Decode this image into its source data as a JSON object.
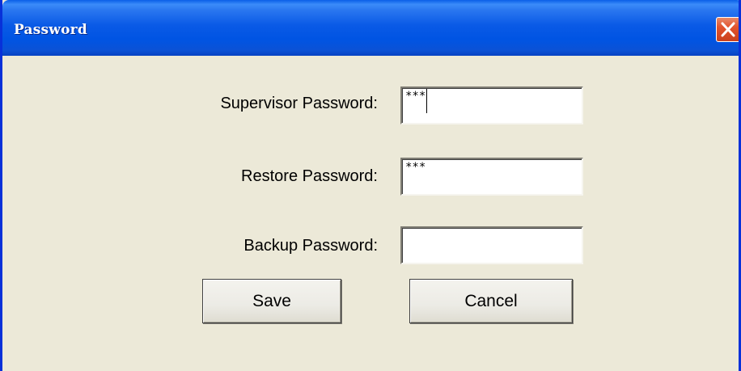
{
  "window": {
    "title": "Password",
    "close_icon": "close-x-icon"
  },
  "fields": [
    {
      "label": "Supervisor Password:",
      "value": "***",
      "focused": true
    },
    {
      "label": "Restore Password:",
      "value": "***",
      "focused": false
    },
    {
      "label": "Backup Password:",
      "value": "",
      "focused": false
    }
  ],
  "buttons": {
    "save_label": "Save",
    "cancel_label": "Cancel"
  },
  "colors": {
    "titlebar": "#0054e3",
    "dialog_background": "#ece9d8",
    "close_button": "#e2532d"
  }
}
